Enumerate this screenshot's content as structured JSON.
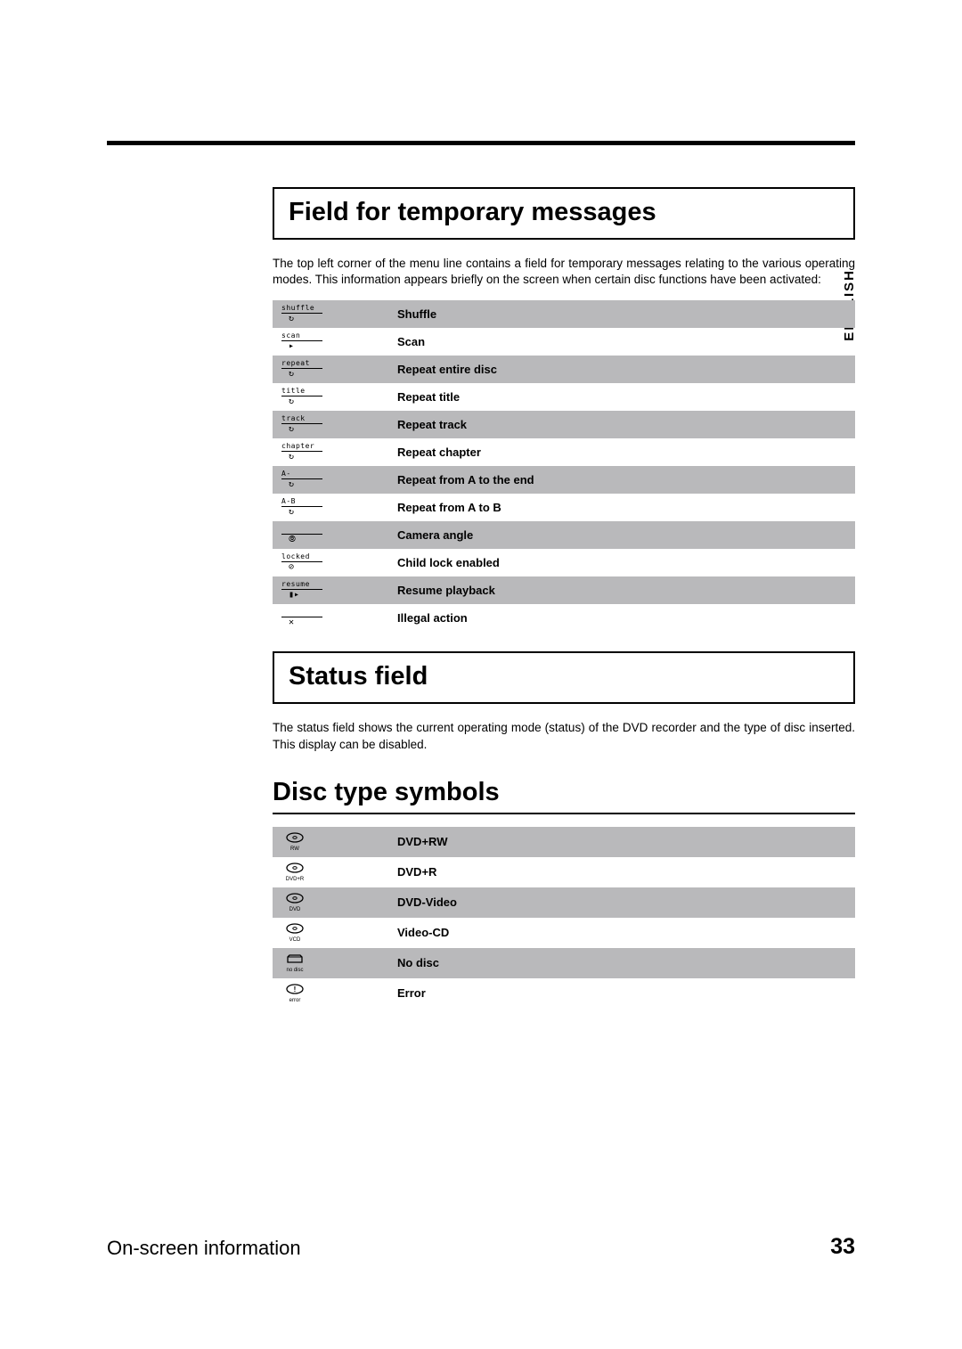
{
  "language_tab": "ENGLISH",
  "footer": {
    "section": "On-screen information",
    "page": "33"
  },
  "section1": {
    "heading": "Field for temporary messages",
    "paragraph": "The top left corner of the menu line contains a field for temporary messages relating to the various operating modes. This information appears briefly on the screen when certain disc functions have been activated:",
    "rows": [
      {
        "icon_label": "shuffle",
        "icon_sym": "↻",
        "desc": "Shuffle"
      },
      {
        "icon_label": "scan",
        "icon_sym": "▸",
        "desc": "Scan"
      },
      {
        "icon_label": "repeat",
        "icon_sym": "↻",
        "desc": "Repeat entire disc"
      },
      {
        "icon_label": "title",
        "icon_sym": "↻",
        "desc": "Repeat title"
      },
      {
        "icon_label": "track",
        "icon_sym": "↻",
        "desc": "Repeat track"
      },
      {
        "icon_label": "chapter",
        "icon_sym": "↻",
        "desc": "Repeat chapter"
      },
      {
        "icon_label": "A-",
        "icon_sym": "↻",
        "desc": "Repeat from A to the end"
      },
      {
        "icon_label": "A-B",
        "icon_sym": "↻",
        "desc": "Repeat from A to B"
      },
      {
        "icon_label": "",
        "icon_sym": "⦾",
        "desc": "Camera angle"
      },
      {
        "icon_label": "locked",
        "icon_sym": "⊘",
        "desc": "Child lock enabled"
      },
      {
        "icon_label": "resume",
        "icon_sym": "▮▸",
        "desc": "Resume playback"
      },
      {
        "icon_label": "",
        "icon_sym": "✕",
        "desc": "Illegal action"
      }
    ]
  },
  "section2": {
    "heading": "Status field",
    "paragraph": "The status field shows the current operating mode (status) of the DVD recorder and the type of disc inserted. This display can be disabled."
  },
  "section3": {
    "heading": "Disc type symbols",
    "rows": [
      {
        "sub": "RW",
        "shape": "disc",
        "desc": "DVD+RW"
      },
      {
        "sub": "DVD+R",
        "shape": "disc",
        "desc": "DVD+R"
      },
      {
        "sub": "DVD",
        "shape": "disc",
        "desc": "DVD-Video"
      },
      {
        "sub": "VCD",
        "shape": "disc",
        "desc": "Video-CD"
      },
      {
        "sub": "no disc",
        "shape": "tray",
        "desc": "No disc"
      },
      {
        "sub": "error",
        "shape": "err",
        "desc": "Error"
      }
    ]
  }
}
